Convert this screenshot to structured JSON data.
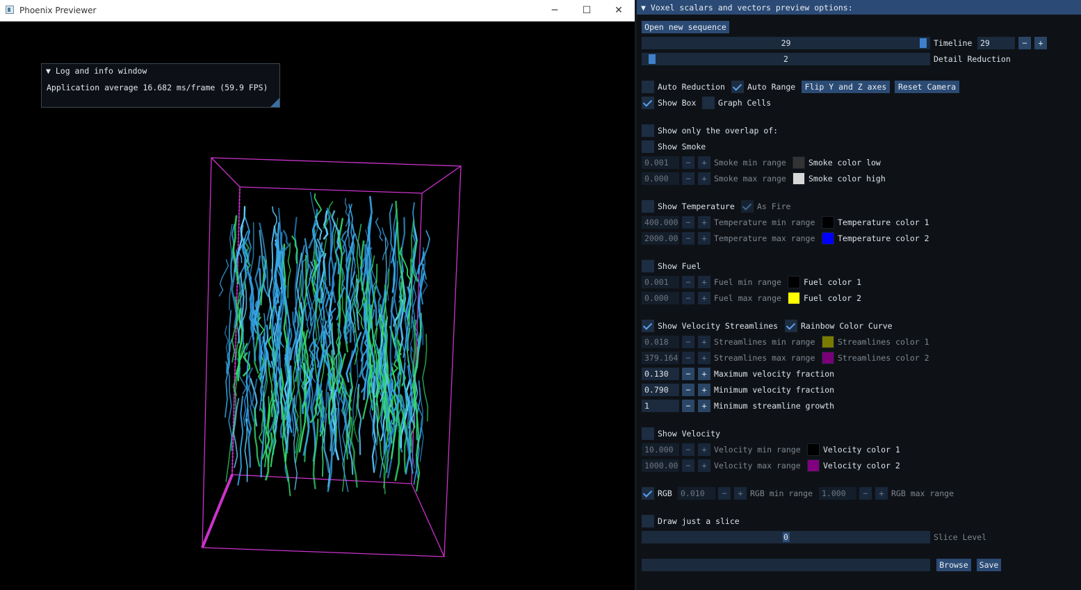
{
  "window": {
    "title": "Phoenix Previewer",
    "minimize_glyph": "─",
    "maximize_glyph": "☐",
    "close_glyph": "✕"
  },
  "log_window": {
    "header": "▼ Log and info window",
    "fps_text": "Application average 16.682 ms/frame (59.9 FPS)"
  },
  "panel": {
    "header": "▼ Voxel scalars and vectors preview options:",
    "open_button": "Open new sequence",
    "timeline": {
      "value": "29",
      "label": "Timeline",
      "input": "29",
      "minus": "−",
      "plus": "+",
      "fraction": 1.0
    },
    "detail": {
      "value": "2",
      "label": "Detail Reduction",
      "fraction": 0.02
    },
    "auto_reduction": {
      "label": "Auto Reduction",
      "checked": false
    },
    "auto_range": {
      "label": "Auto Range",
      "checked": true
    },
    "flip_button": "Flip Y and Z axes",
    "reset_button": "Reset Camera",
    "show_box": {
      "label": "Show Box",
      "checked": true
    },
    "graph_cells": {
      "label": "Graph Cells",
      "checked": false
    },
    "overlap": {
      "label": "Show only the overlap of:",
      "checked": false
    },
    "smoke": {
      "label": "Show Smoke",
      "checked": false,
      "min": "0.001",
      "min_label": "Smoke min range",
      "color_low_label": "Smoke color low",
      "color_low": "#333333",
      "max": "0.000",
      "max_label": "Smoke max range",
      "color_high_label": "Smoke color high",
      "color_high": "#d8d8d8"
    },
    "temperature": {
      "label": "Show Temperature",
      "checked": false,
      "as_fire_label": "As Fire",
      "as_fire": true,
      "min": "400.000",
      "min_label": "Temperature min range",
      "color1_label": "Temperature color 1",
      "color1": "#000000",
      "max": "2000.00",
      "max_label": "Temperature max range",
      "color2_label": "Temperature color 2",
      "color2": "#0000ff"
    },
    "fuel": {
      "label": "Show Fuel",
      "checked": false,
      "min": "0.001",
      "min_label": "Fuel min range",
      "color1_label": "Fuel color 1",
      "color1": "#000000",
      "max": "0.000",
      "max_label": "Fuel max range",
      "color2_label": "Fuel color 2",
      "color2": "#ffff00"
    },
    "streamlines": {
      "label": "Show Velocity Streamlines",
      "checked": true,
      "rainbow_label": "Rainbow Color Curve",
      "rainbow": true,
      "min": "0.018",
      "min_label": "Streamlines min range",
      "color1_label": "Streamlines color 1",
      "color1": "#7a7a00",
      "max": "379.164",
      "max_label": "Streamlines max range",
      "color2_label": "Streamlines color 2",
      "color2": "#7a007a",
      "max_frac": "0.130",
      "max_frac_label": "Maximum velocity fraction",
      "min_frac": "0.790",
      "min_frac_label": "Minimum velocity fraction",
      "growth": "1",
      "growth_label": "Minimum streamline growth"
    },
    "velocity": {
      "label": "Show Velocity",
      "checked": false,
      "min": "10.000",
      "min_label": "Velocity min range",
      "color1_label": "Velocity color 1",
      "color1": "#000000",
      "max": "1000.00",
      "max_label": "Velocity max range",
      "color2_label": "Velocity color 2",
      "color2": "#800080"
    },
    "rgb": {
      "label": "RGB",
      "checked": true,
      "min": "0.010",
      "min_label": "RGB min range",
      "max": "1.000",
      "max_label": "RGB max range"
    },
    "slice": {
      "label": "Draw just a slice",
      "checked": false,
      "value": "0",
      "slider_label": "Slice Level",
      "fraction": 0.5
    },
    "path": {
      "value": ""
    },
    "browse_button": "Browse",
    "save_button": "Save"
  },
  "colors": {
    "accent": "#2c4b74",
    "box_outline": "#cc33cc",
    "streamline_main": "#35a7e8",
    "streamline_light": "#5fd0ff",
    "streamline_green": "#32d86a"
  }
}
